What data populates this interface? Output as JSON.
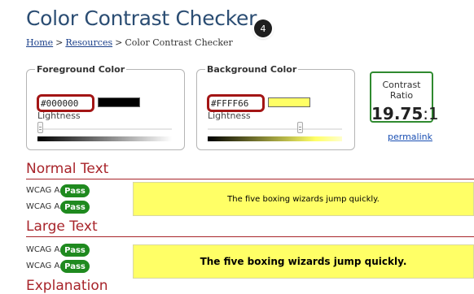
{
  "page": {
    "title": "Color Contrast Checker",
    "step_badge": "4"
  },
  "breadcrumb": {
    "home": "Home",
    "separator": ">",
    "resources": "Resources",
    "current": "Color Contrast Checker"
  },
  "foreground": {
    "legend": "Foreground Color",
    "hex_value": "#000000",
    "swatch_color": "#000000",
    "lightness_label": "Lightness"
  },
  "background": {
    "legend": "Background Color",
    "hex_value": "#FFFF66",
    "swatch_color": "#FFFF66",
    "lightness_label": "Lightness"
  },
  "contrast": {
    "label": "Contrast Ratio",
    "value": "19.75",
    "suffix": ":1",
    "permalink": "permalink"
  },
  "normal_text": {
    "title": "Normal Text",
    "aa_label": "WCAG AA:",
    "aa_result": "Pass",
    "aaa_label": "WCAG AAA:",
    "aaa_result": "Pass",
    "sample": "The five boxing wizards jump quickly."
  },
  "large_text": {
    "title": "Large Text",
    "aa_label": "WCAG AA:",
    "aa_result": "Pass",
    "aaa_label": "WCAG AAA:",
    "aaa_result": "Pass",
    "sample": "The five boxing wizards jump quickly."
  },
  "explanation": {
    "title": "Explanation"
  },
  "colors": {
    "heading": "#2b4d73",
    "section": "#a8242a",
    "pass": "#1f8a1f",
    "input_highlight": "#a31515"
  }
}
